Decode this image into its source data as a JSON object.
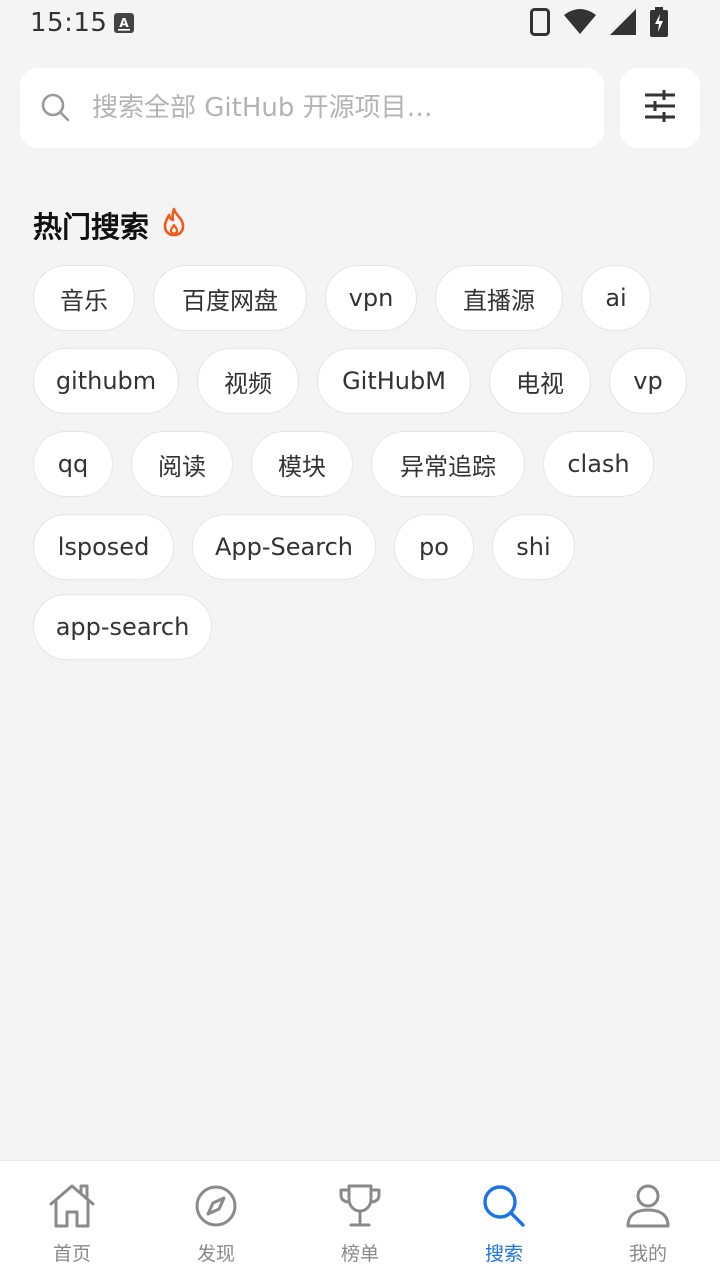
{
  "status_bar": {
    "time": "15:15",
    "icons": [
      "keyboard-a-icon",
      "phone-icon",
      "wifi-icon",
      "signal-icon",
      "battery-charging-icon"
    ]
  },
  "search": {
    "placeholder": "搜索全部 GitHub 开源项目…",
    "value": "",
    "search_icon": "search-icon",
    "filter_icon": "sliders-icon"
  },
  "hot_search": {
    "title": "热门搜索",
    "title_icon": "fire-icon",
    "accent_color": "#f25a1a",
    "tags": [
      "音乐",
      "百度网盘",
      "vpn",
      "直播源",
      "ai",
      "githubm",
      "视频",
      "GitHubM",
      "电视",
      "vp",
      "qq",
      "阅读",
      "模块",
      "异常追踪",
      "clash",
      "lsposed",
      "App-Search",
      "po",
      "shi",
      "app-search"
    ]
  },
  "bottom_nav": {
    "active_color": "#1a73e8",
    "inactive_color": "#8a8a8a",
    "items": [
      {
        "label": "首页",
        "icon": "home-icon",
        "active": false
      },
      {
        "label": "发现",
        "icon": "compass-icon",
        "active": false
      },
      {
        "label": "榜单",
        "icon": "trophy-icon",
        "active": false
      },
      {
        "label": "搜索",
        "icon": "search-icon",
        "active": true
      },
      {
        "label": "我的",
        "icon": "user-icon",
        "active": false
      }
    ]
  }
}
